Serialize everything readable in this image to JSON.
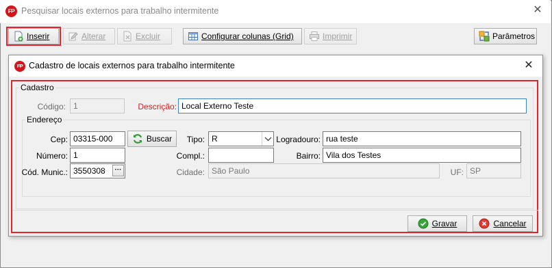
{
  "window": {
    "title": "Pesquisar locais externos para trabalho intermitente",
    "logo_text": "FP",
    "close_glyph": "✕"
  },
  "toolbar": {
    "inserir": "Inserir",
    "alterar": "Alterar",
    "excluir": "Excluir",
    "configurar_colunas": "Configurar colunas (Grid)",
    "imprimir": "Imprimir",
    "parametros": "Parâmetros"
  },
  "dialog": {
    "title": "Cadastro de locais externos para trabalho intermitente",
    "cadastro_group": "Cadastro",
    "codigo_label": "Código:",
    "codigo_value": "1",
    "descricao_label": "Descrição:",
    "descricao_value": "Local Externo Teste",
    "endereco_group": "Endereço",
    "cep_label": "Cep:",
    "cep_value": "03315-000",
    "buscar": "Buscar",
    "tipo_label": "Tipo:",
    "tipo_value": "R",
    "logradouro_label": "Logradouro:",
    "logradouro_value": "rua teste",
    "numero_label": "Número:",
    "numero_value": "1",
    "compl_label": "Compl.:",
    "compl_value": "",
    "bairro_label": "Bairro:",
    "bairro_value": "Vila dos Testes",
    "cod_munic_label": "Cód. Munic.:",
    "cod_munic_value": "3550308",
    "ellipsis": "···",
    "cidade_label": "Cidade:",
    "cidade_value": "São Paulo",
    "uf_label": "UF:",
    "uf_value": "SP",
    "gravar": "Gravar",
    "cancelar": "Cancelar"
  },
  "colors": {
    "highlight": "#e5232b",
    "required_label": "#d52020",
    "logo_bg": "#d5141b"
  }
}
